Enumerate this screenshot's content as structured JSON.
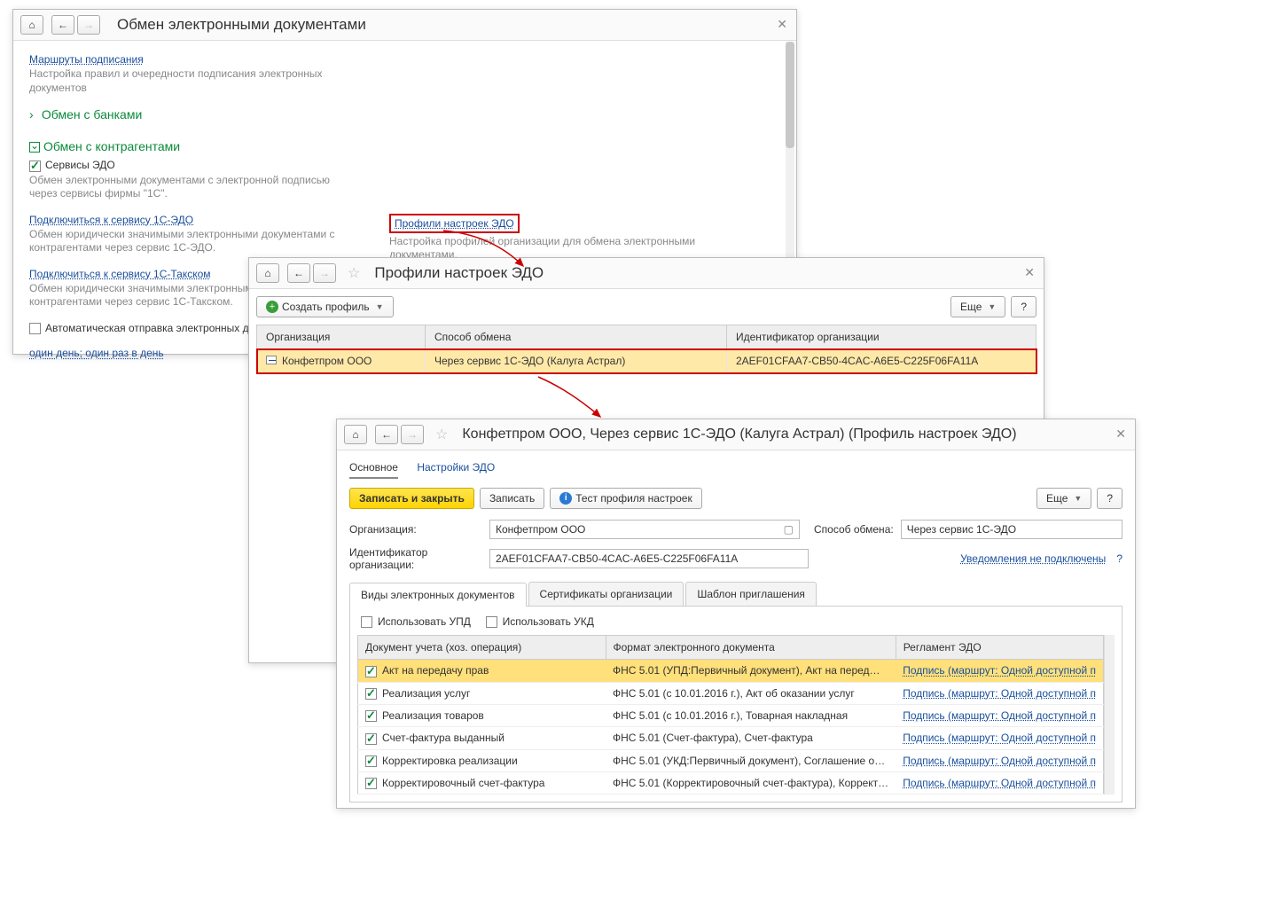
{
  "win1": {
    "title": "Обмен электронными документами",
    "link_routes": "Маршруты подписания",
    "routes_desc": "Настройка правил и очередности подписания электронных документов",
    "sect_banks": "Обмен с банками",
    "sect_contragents": "Обмен с контрагентами",
    "chk_services": "Сервисы ЭДО",
    "services_desc": "Обмен электронными документами с электронной подписью через сервисы фирмы \"1С\".",
    "connect_edo": "Подключиться к сервису 1С-ЭДО",
    "connect_edo_desc": "Обмен юридически значимыми электронными документами с контрагентами через сервис 1С-ЭДО.",
    "profiles_link": "Профили настроек ЭДО",
    "profiles_desc": "Настройка профилей организации для обмена электронными документами.",
    "connect_taxcom": "Подключиться к сервису 1С-Такском",
    "connect_taxcom_desc": "Обмен юридически значимыми электронными документами с контрагентами через сервис 1С-Такском.",
    "auto_send": "Автоматическая отправка электронных документов",
    "schedule": "один день; один раз в день"
  },
  "win2": {
    "title": "Профили настроек ЭДО",
    "create": "Создать профиль",
    "more": "Еще",
    "help": "?",
    "cols": {
      "org": "Организация",
      "method": "Способ обмена",
      "id": "Идентификатор организации"
    },
    "row": {
      "org": "Конфетпром ООО",
      "method": "Через сервис 1С-ЭДО (Калуга Астрал)",
      "id": "2AEF01CFAA7-CB50-4CAC-A6E5-C225F06FA11A"
    }
  },
  "win3": {
    "title": "Конфетпром ООО, Через сервис 1С-ЭДО (Калуга Астрал) (Профиль настроек ЭДО)",
    "nav_main": "Основное",
    "nav_settings": "Настройки ЭДО",
    "save_close": "Записать и закрыть",
    "save": "Записать",
    "test": "Тест профиля настроек",
    "more": "Еще",
    "help": "?",
    "lbl_org": "Организация:",
    "val_org": "Конфетпром ООО",
    "lbl_method": "Способ обмена:",
    "val_method": "Через сервис 1С-ЭДО",
    "lbl_id": "Идентификатор организации:",
    "val_id": "2AEF01CFAA7-CB50-4CAC-A6E5-C225F06FA11A",
    "notif": "Уведомления не подключены",
    "qmark": "?",
    "tabs": {
      "t1": "Виды электронных документов",
      "t2": "Сертификаты организации",
      "t3": "Шаблон приглашения"
    },
    "use_upd": "Использовать УПД",
    "use_ukd": "Использовать УКД",
    "tcols": {
      "c1": "Документ учета (хоз. операция)",
      "c2": "Формат электронного документа",
      "c3": "Регламент ЭДО"
    },
    "rows": [
      {
        "doc": "Акт на передачу прав",
        "fmt": "ФНС 5.01 (УПД:Первичный документ), Акт на перед…",
        "reg": "Подпись (маршрут: Одной доступной п"
      },
      {
        "doc": "Реализация услуг",
        "fmt": "ФНС 5.01 (с 10.01.2016 г.), Акт об оказании услуг",
        "reg": "Подпись (маршрут: Одной доступной п"
      },
      {
        "doc": "Реализация товаров",
        "fmt": "ФНС 5.01 (с 10.01.2016 г.), Товарная накладная",
        "reg": "Подпись (маршрут: Одной доступной п"
      },
      {
        "doc": "Счет-фактура выданный",
        "fmt": "ФНС 5.01 (Счет-фактура), Счет-фактура",
        "reg": "Подпись (маршрут: Одной доступной п"
      },
      {
        "doc": "Корректировка реализации",
        "fmt": "ФНС 5.01 (УКД:Первичный документ), Соглашение о…",
        "reg": "Подпись (маршрут: Одной доступной п"
      },
      {
        "doc": "Корректировочный счет-фактура",
        "fmt": "ФНС 5.01 (Корректировочный счет-фактура), Коррект…",
        "reg": "Подпись (маршрут: Одной доступной п"
      }
    ]
  }
}
